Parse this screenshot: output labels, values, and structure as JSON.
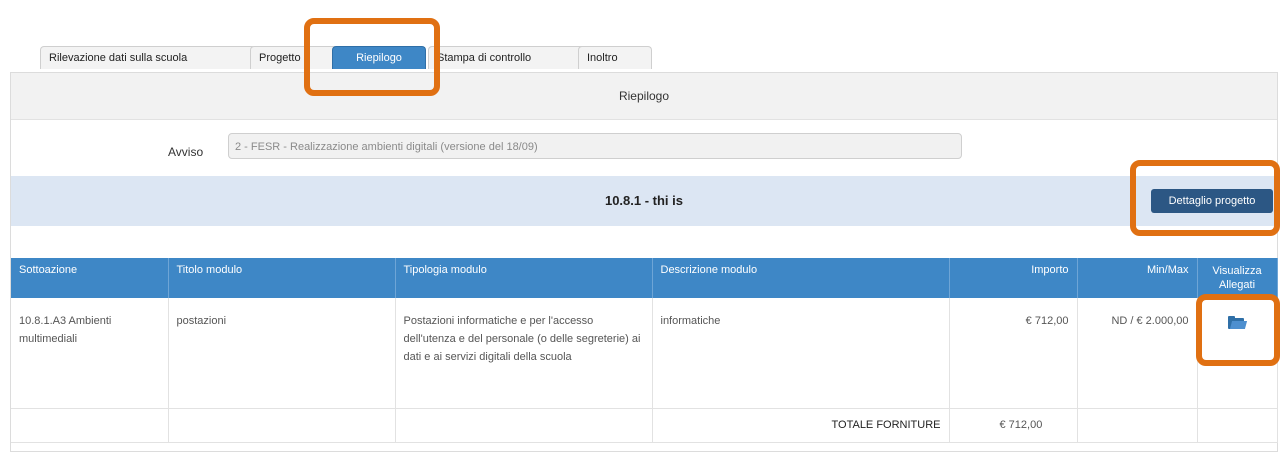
{
  "tabs": [
    {
      "label": "Rilevazione dati sulla scuola"
    },
    {
      "label": "Progetto"
    },
    {
      "label": "Riepilogo"
    },
    {
      "label": "Stampa di controllo"
    },
    {
      "label": "Inoltro"
    }
  ],
  "panel": {
    "title": "Riepilogo"
  },
  "avviso": {
    "label": "Avviso",
    "value": "2 - FESR - Realizzazione ambienti digitali (versione del 18/09)"
  },
  "section": {
    "title": "10.8.1 - thi is",
    "detail_button": "Dettaglio progetto"
  },
  "table": {
    "headers": [
      "Sottoazione",
      "Titolo modulo",
      "Tipologia modulo",
      "Descrizione modulo",
      "Importo",
      "Min/Max",
      "Visualizza Allegati"
    ],
    "row": {
      "sottoazione": "10.8.1.A3 Ambienti multimediali",
      "titolo": "postazioni",
      "tipologia": "Postazioni informatiche e per l'accesso dell'utenza e del personale (o delle segreterie) ai dati e ai servizi digitali della scuola",
      "descrizione": "informatiche",
      "importo": "€ 712,00",
      "minmax": "ND / € 2.000,00"
    },
    "total": {
      "label": "TOTALE FORNITURE",
      "value": "€ 712,00"
    }
  },
  "icons": {
    "allegati": "folder-open-icon"
  },
  "colors": {
    "tab_active": "#3e87c6",
    "header_blue": "#3e87c6",
    "button_dark": "#2c5784",
    "highlight": "#e07012",
    "section_bg": "#dce6f3"
  }
}
